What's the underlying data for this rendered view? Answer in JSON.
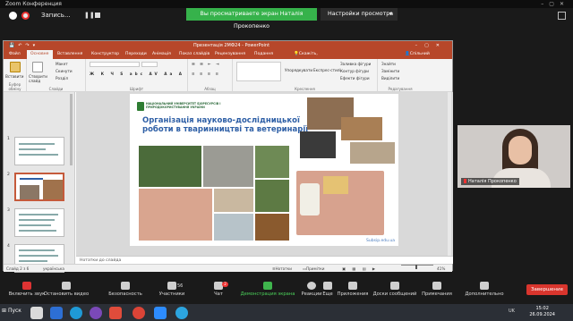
{
  "titlebar": {
    "title": "Zoom Конференция"
  },
  "zoombar": {
    "record_label": "Запись...",
    "banner_text": "Вы просматриваете экран Наталія Прокопенко",
    "view_options": "Настройки просмотра"
  },
  "ppt": {
    "window_title": "Презентація 2МФ24 - PowerPoint",
    "tabs": [
      "Файл",
      "Основне",
      "Вставлення",
      "Конструктор",
      "Переходи",
      "Анімація",
      "Показ слайдів",
      "Рецензування",
      "Подання"
    ],
    "tell_me": "Скажіть, що потрібно зробити",
    "share": "Спільний доступ",
    "ribbon": {
      "paste": "Вставити",
      "clipboard": "Буфер обміну",
      "new_slide": "Створити слайд",
      "layout": "Макет",
      "reset": "Скинути",
      "section": "Розділ",
      "slides": "Слайди",
      "font": "Шрифт",
      "paragraph": "Абзац",
      "arrange": "Упорядкувати",
      "quick_styles": "Експрес-стилі",
      "drawing": "Креслення",
      "shape_fill": "Заливка фігури",
      "shape_outline": "Контур фігури",
      "shape_effects": "Ефекти фігури",
      "find": "Знайти",
      "replace": "Замінити",
      "select": "Виділити",
      "editing": "Редагування"
    },
    "slide": {
      "university": "НАЦІОНАЛЬНИЙ УНІВЕРСИТЕТ БІОРЕСУРСІВ І ПРИРОДОКОРИСТУВАННЯ УКРАЇНИ",
      "title": "Організація науково-дослідницької роботи в тваринництві та ветеринарії",
      "footer": "Subsip.edu.ua"
    },
    "notes_placeholder": "Нотатки до слайда",
    "status": {
      "slide_counter": "Слайд 2 з 6",
      "language": "українська",
      "notes": "Нотатки",
      "comments": "Примітки",
      "zoom": "41%"
    }
  },
  "participant": {
    "name": "Наталія Прокопенко"
  },
  "toolbar": {
    "mic": "Включить звук",
    "video": "Остановить видео",
    "security": "Безопасность",
    "participants": "Участники",
    "participants_count": "56",
    "chat": "Чат",
    "chat_badge": "2",
    "share": "Демонстрация экрана",
    "reactions": "Реакции",
    "more": "Еще",
    "apps": "Приложения",
    "whiteboards": "Доски сообщений",
    "notes": "Примечания",
    "more2": "Дополнительно",
    "end": "Завершение"
  },
  "taskbar": {
    "start": "Пуск",
    "lang": "UK",
    "time": "15:02",
    "date": "26.09.2024"
  },
  "colors": {
    "ppt_accent": "#b7472a",
    "zoom_green": "#36b24b",
    "end_red": "#d9352d",
    "slide_title": "#2e5fa6"
  }
}
